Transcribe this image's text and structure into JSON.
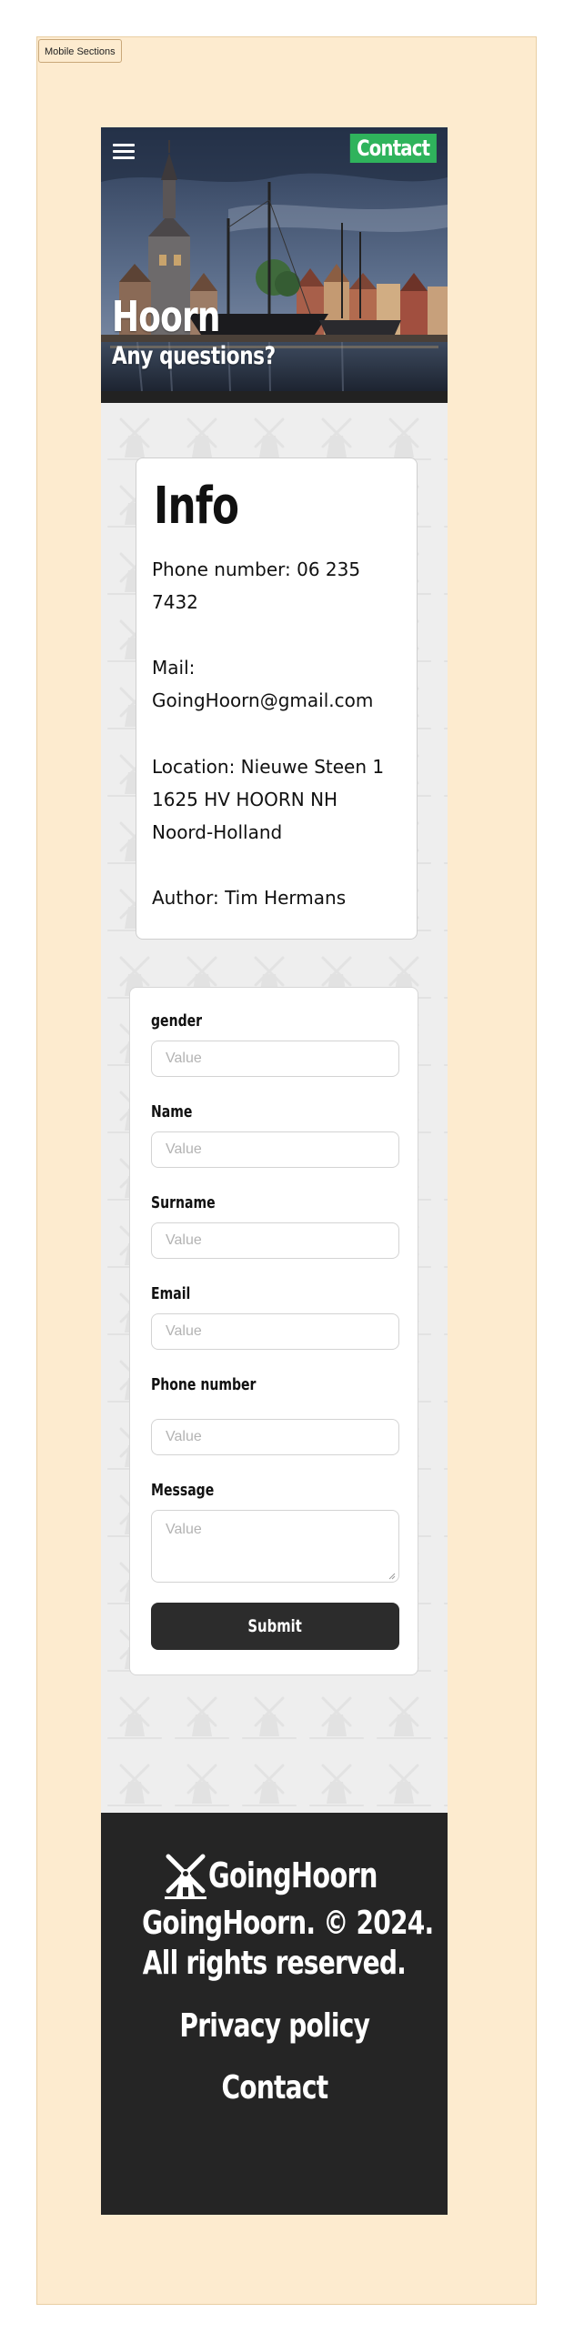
{
  "artboard": {
    "label": "Mobile Sections"
  },
  "header": {
    "menu_icon": "hamburger-menu-icon",
    "contact_label": "Contact",
    "title": "Hoorn",
    "subtitle": "Any questions?"
  },
  "info": {
    "title": "Info",
    "phone_line1": "Phone number: 06 235",
    "phone_line2": "7432",
    "mail_line1": "Mail:",
    "mail_line2": "GoingHoorn@gmail.com",
    "location_line1": "Location: Nieuwe Steen 1",
    "location_line2": "1625 HV HOORN NH",
    "location_line3": "Noord-Holland",
    "author": "Author: Tim Hermans"
  },
  "form": {
    "fields": [
      {
        "label": "gender",
        "placeholder": "Value"
      },
      {
        "label": "Name",
        "placeholder": "Value"
      },
      {
        "label": "Surname",
        "placeholder": "Value"
      },
      {
        "label": "Email",
        "placeholder": "Value"
      },
      {
        "label": "Phone number",
        "placeholder": "Value"
      },
      {
        "label": "Message",
        "placeholder": "Value"
      }
    ],
    "submit_label": "Submit"
  },
  "footer": {
    "brand": "GoingHoorn",
    "brand_icon": "windmill-icon",
    "copyright_line1": "GoingHoorn. © 2024.",
    "copyright_line2": "All rights reserved.",
    "privacy_link": "Privacy policy",
    "contact_link": "Contact"
  },
  "colors": {
    "artboard_bg": "#fdebcf",
    "accent_green": "#2fb35c",
    "footer_bg": "#252525",
    "page_bg": "#eeeeee"
  }
}
